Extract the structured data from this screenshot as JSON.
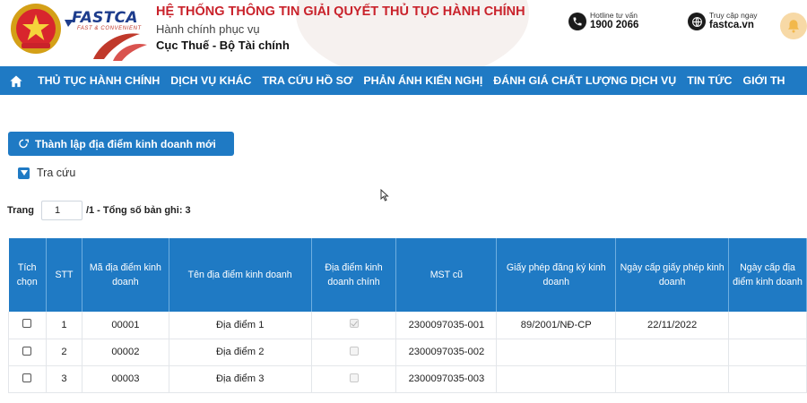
{
  "header": {
    "logo_text": "FASTCA",
    "logo_tagline": "FAST & CONVENIENT",
    "system_title": "HỆ THỐNG THÔNG TIN GIẢI QUYẾT THỦ TỤC HÀNH CHÍNH",
    "subtitle": "Hành chính phục vụ",
    "agency": "Cục Thuế - Bộ Tài chính",
    "hotline": {
      "label": "Hotline tư vấn",
      "value": "1900 2066",
      "icon": "phone-icon"
    },
    "website": {
      "label": "Truy cập ngay",
      "value": "fastca.vn",
      "icon": "globe-icon"
    }
  },
  "nav": {
    "home_icon": "home-icon",
    "items": [
      {
        "label": "THỦ TỤC HÀNH CHÍNH"
      },
      {
        "label": "DỊCH VỤ KHÁC"
      },
      {
        "label": "TRA CỨU HỒ SƠ"
      },
      {
        "label": "PHẢN ÁNH KIẾN NGHỊ"
      },
      {
        "label": "ĐÁNH GIÁ CHẤT LƯỢNG DỊCH VỤ"
      },
      {
        "label": "TIN TỨC"
      },
      {
        "label": "GIỚI TH"
      }
    ]
  },
  "actions": {
    "create_label": "Thành lập địa điểm kinh doanh mới",
    "search_toggle_label": "Tra cứu"
  },
  "pager": {
    "page_label": "Trang",
    "page_value": "1",
    "summary": "/1 - Tổng số bản ghi: 3"
  },
  "table": {
    "headers": [
      "Tích chọn",
      "STT",
      "Mã địa điểm kinh doanh",
      "Tên địa điểm kinh doanh",
      "Địa điểm kinh doanh chính",
      "MST cũ",
      "Giấy phép đăng ký kinh doanh",
      "Ngày cấp giấy phép kinh doanh",
      "Ngày cấp địa điểm kinh doanh"
    ],
    "rows": [
      {
        "stt": "1",
        "code": "00001",
        "name": "Địa điểm 1",
        "main": true,
        "mst": "2300097035-001",
        "license": "89/2001/NĐ-CP",
        "license_date": "22/11/2022",
        "site_date": ""
      },
      {
        "stt": "2",
        "code": "00002",
        "name": "Địa điểm 2",
        "main": false,
        "mst": "2300097035-002",
        "license": "",
        "license_date": "",
        "site_date": ""
      },
      {
        "stt": "3",
        "code": "00003",
        "name": "Địa điểm 3",
        "main": false,
        "mst": "2300097035-003",
        "license": "",
        "license_date": "",
        "site_date": ""
      }
    ]
  },
  "colors": {
    "nav_bg": "#1f7ac4",
    "title_red": "#c9222b",
    "logo_blue": "#1d3c8c"
  }
}
